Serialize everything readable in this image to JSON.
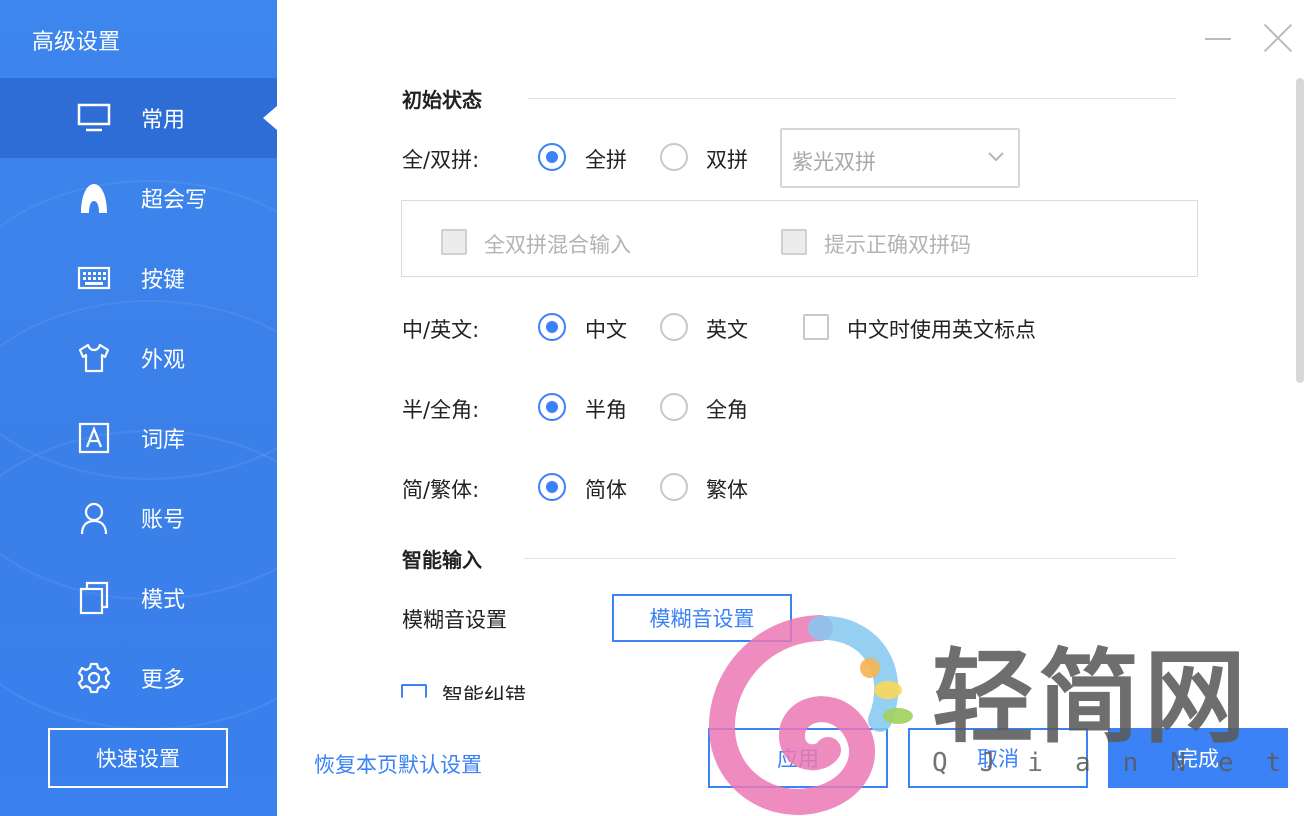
{
  "sidebar": {
    "title": "高级设置",
    "items": [
      {
        "label": "常用",
        "icon": "monitor-icon"
      },
      {
        "label": "超会写",
        "icon": "pen-icon"
      },
      {
        "label": "按键",
        "icon": "keyboard-icon"
      },
      {
        "label": "外观",
        "icon": "shirt-icon"
      },
      {
        "label": "词库",
        "icon": "dictionary-icon"
      },
      {
        "label": "账号",
        "icon": "user-icon"
      },
      {
        "label": "模式",
        "icon": "mode-icon"
      },
      {
        "label": "更多",
        "icon": "gear-icon"
      }
    ],
    "active_index": 0,
    "quick_setup": "快速设置"
  },
  "main": {
    "sections": {
      "initial_state": "初始状态",
      "smart_input": "智能输入"
    },
    "pinyin_mode": {
      "label": "全/双拼:",
      "option_full": "全拼",
      "option_double": "双拼",
      "selected": "全拼",
      "scheme": "紫光双拼",
      "mixed_input": "全双拼混合输入",
      "show_correct": "提示正确双拼码"
    },
    "language": {
      "label": "中/英文:",
      "option_cn": "中文",
      "option_en": "英文",
      "selected": "中文",
      "english_punct": "中文时使用英文标点"
    },
    "width": {
      "label": "半/全角:",
      "option_half": "半角",
      "option_full": "全角",
      "selected": "半角"
    },
    "script": {
      "label": "简/繁体:",
      "option_simplified": "简体",
      "option_traditional": "繁体",
      "selected": "简体"
    },
    "fuzzy": {
      "label": "模糊音设置",
      "button": "模糊音设置"
    },
    "smart_pinyin_cut": "智能纠错"
  },
  "footer": {
    "restore_defaults": "恢复本页默认设置",
    "apply": "应用",
    "cancel": "取消",
    "done": "完成"
  },
  "watermark": {
    "title": "轻简网",
    "subtitle": "QJianNet"
  },
  "colors": {
    "accent": "#3b82f6",
    "sidebar": "#3b80ec",
    "sidebar_active": "#2f6dd6"
  }
}
